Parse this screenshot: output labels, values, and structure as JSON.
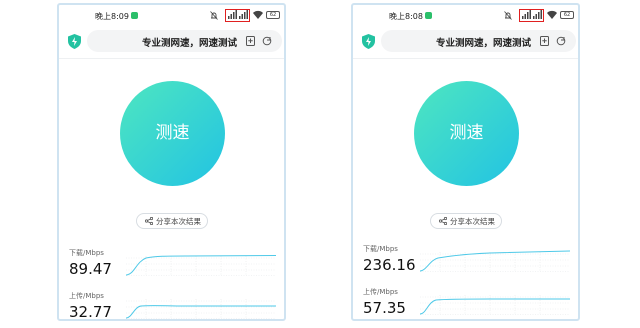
{
  "phones": [
    {
      "time": "晚上8:09",
      "url_title": "专业测网速，网速测试",
      "speed_button": "测速",
      "share_label": "分享本次结果",
      "battery": "62",
      "download_label": "下载/Mbps",
      "download_value": "89.47",
      "upload_label": "上传/Mbps",
      "upload_value": "32.77"
    },
    {
      "time": "晚上8:08",
      "url_title": "专业测网速，网速测试",
      "speed_button": "测速",
      "share_label": "分享本次结果",
      "battery": "62",
      "download_label": "下载/Mbps",
      "download_value": "236.16",
      "upload_label": "上传/Mbps",
      "upload_value": "57.35"
    }
  ],
  "colors": {
    "accent_start": "#4ee6c0",
    "accent_end": "#22c3e3",
    "graph_line": "#4ec9e8",
    "highlight_box": "#e02020"
  },
  "icons": [
    "shield-icon",
    "bookmark-icon",
    "reload-icon",
    "share-icon",
    "wifi-icon",
    "signal-icon",
    "battery-icon",
    "mute-bell-icon"
  ]
}
